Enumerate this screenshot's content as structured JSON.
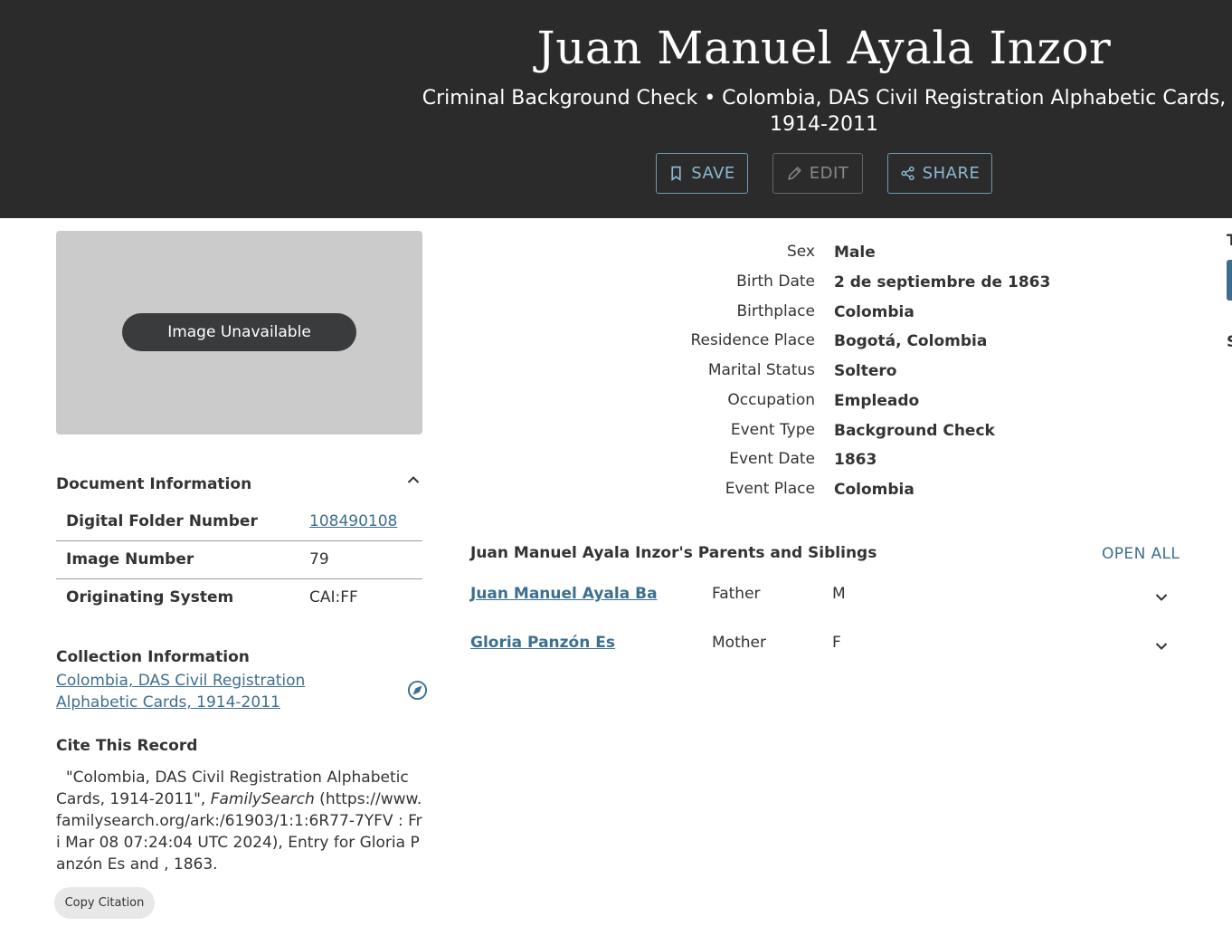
{
  "header": {
    "name": "Juan Manuel Ayala Inzor",
    "subtitle": "Criminal Background Check • Colombia, DAS Civil Registration Alphabetic Cards, 1914-2011",
    "save_label": "SAVE",
    "edit_label": "EDIT",
    "share_label": "SHARE"
  },
  "image": {
    "label": "Image Unavailable"
  },
  "document_info": {
    "title": "Document Information",
    "rows": [
      {
        "key": "Digital Folder Number",
        "value": "108490108"
      },
      {
        "key": "Image Number",
        "value": "79"
      },
      {
        "key": "Originating System",
        "value": "CAI:FF"
      }
    ]
  },
  "collection_info": {
    "title": "Collection Information",
    "link": "Colombia, DAS Civil Registration Alphabetic Cards, 1914-2011"
  },
  "citation": {
    "title": "Cite This Record",
    "text_before": "\"Colombia, DAS Civil Registration Alphabetic Cards, 1914-2011\", ",
    "source": "FamilySearch",
    "text_after": " (https://www.familysearch.org/ark:/61903/1:1:6R77-7YFV : Fri Mar 08 07:24:04 UTC 2024), Entry for Gloria Panzón Es and , 1863.",
    "copy_label": "Copy Citation"
  },
  "facts": [
    {
      "key": "Sex",
      "value": "Male"
    },
    {
      "key": "Birth Date",
      "value": "2 de septiembre de 1863"
    },
    {
      "key": "Birthplace",
      "value": "Colombia"
    },
    {
      "key": "Residence Place",
      "value": "Bogotá, Colombia"
    },
    {
      "key": "Marital Status",
      "value": "Soltero"
    },
    {
      "key": "Occupation",
      "value": "Empleado"
    },
    {
      "key": "Event Type",
      "value": "Background Check"
    },
    {
      "key": "Event Date",
      "value": "1863"
    },
    {
      "key": "Event Place",
      "value": "Colombia"
    }
  ],
  "family": {
    "title": "Juan Manuel Ayala Inzor's Parents and Siblings",
    "open_all": "OPEN ALL",
    "members": [
      {
        "name": "Juan Manuel Ayala Ba",
        "relation": "Father",
        "sex": "M"
      },
      {
        "name": "Gloria Panzón Es",
        "relation": "Mother",
        "sex": "F"
      }
    ]
  },
  "edge": {
    "t": "T",
    "s": "S"
  },
  "colors": {
    "header_bg": "#2b2b2b",
    "link": "#3c6f8f",
    "accent_button": "#8ab9d3"
  },
  "icons": [
    "bookmark-icon",
    "pencil-icon",
    "share-icon",
    "chevron-up-icon",
    "compass-icon",
    "chevron-down-icon"
  ]
}
